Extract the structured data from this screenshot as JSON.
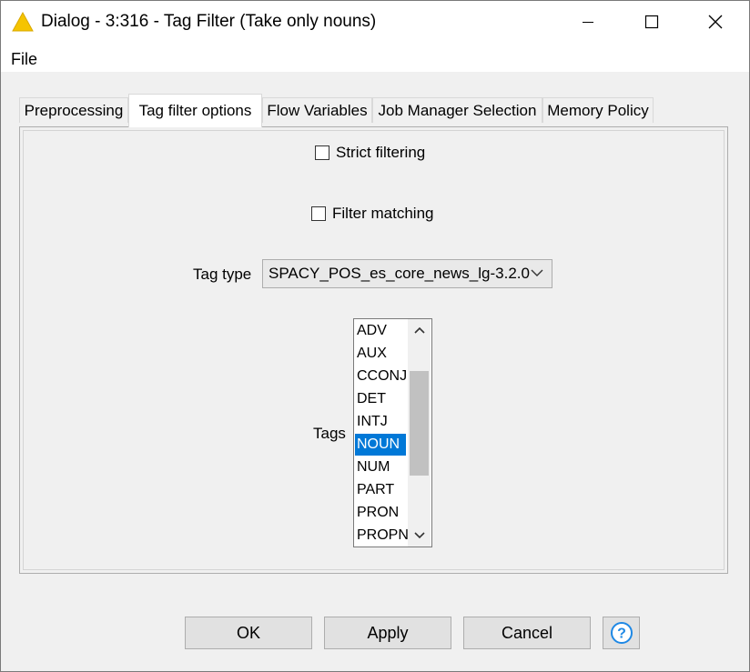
{
  "window": {
    "title": "Dialog - 3:316 - Tag Filter (Take only nouns)",
    "icons": {
      "app": "warning-triangle-icon",
      "minimize": "minimize-icon",
      "maximize": "maximize-icon",
      "close": "close-icon"
    },
    "colors": {
      "accent": "#0078d7",
      "warning": "#f5c400"
    }
  },
  "menu": {
    "file": "File"
  },
  "tabs": [
    {
      "label": "Preprocessing"
    },
    {
      "label": "Tag filter options",
      "active": true
    },
    {
      "label": "Flow Variables"
    },
    {
      "label": "Job Manager Selection"
    },
    {
      "label": "Memory Policy"
    }
  ],
  "options": {
    "strict_filtering": {
      "label": "Strict filtering",
      "checked": false
    },
    "filter_matching": {
      "label": "Filter matching",
      "checked": false
    },
    "tag_type": {
      "label": "Tag type",
      "value": "SPACY_POS_es_core_news_lg-3.2.0"
    },
    "tags": {
      "label": "Tags",
      "items": [
        "ADV",
        "AUX",
        "CCONJ",
        "DET",
        "INTJ",
        "NOUN",
        "NUM",
        "PART",
        "PRON",
        "PROPN"
      ],
      "selected": "NOUN"
    }
  },
  "buttons": {
    "ok": "OK",
    "apply": "Apply",
    "cancel": "Cancel",
    "help_icon": "help-icon"
  }
}
